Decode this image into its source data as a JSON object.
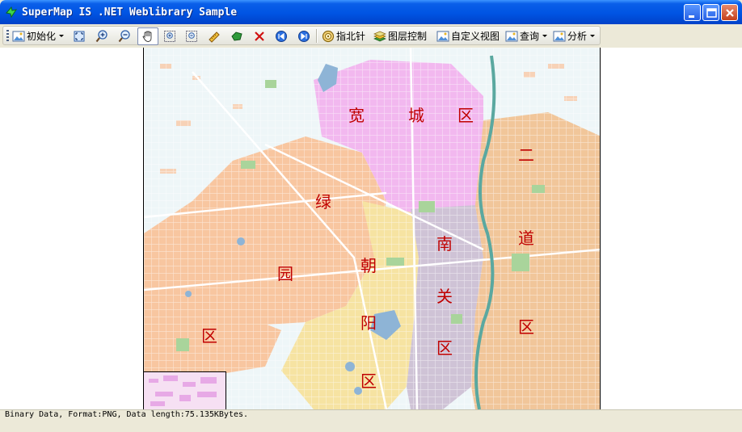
{
  "window": {
    "title": "SuperMap IS .NET Weblibrary Sample",
    "controls": [
      "minimize-icon",
      "maximize-icon",
      "close-icon"
    ]
  },
  "toolbar": {
    "init_label": "初始化",
    "tools": [
      "full-extent-icon",
      "zoom-in-icon",
      "zoom-out-icon",
      "pan-hand-icon",
      "zoom-box-in-icon",
      "zoom-box-out-icon",
      "measure-distance-icon",
      "measure-area-icon",
      "clear-icon",
      "back-icon",
      "forward-icon"
    ],
    "compass_label": "指北针",
    "layers_label": "图层控制",
    "custom_view_label": "自定义视图",
    "query_label": "查询",
    "analysis_label": "分析"
  },
  "map": {
    "district_labels": [
      "宽",
      "城",
      "区",
      "二",
      "道",
      "绿",
      "园",
      "区",
      "朝",
      "阳",
      "区",
      "南",
      "关",
      "区",
      "区"
    ],
    "colors": {
      "kuancheng": "#f2b8ef",
      "erdao": "#f1c69a",
      "lvyuan": "#f8c6a0",
      "chaoyang": "#f6e3a2",
      "nanguan": "#cfc3d6",
      "green": "#a9d49b",
      "water": "#8eb4d6",
      "background": "#eef6f8"
    }
  },
  "status": {
    "text": "Binary Data, Format:PNG, Data length:75.135KBytes."
  }
}
